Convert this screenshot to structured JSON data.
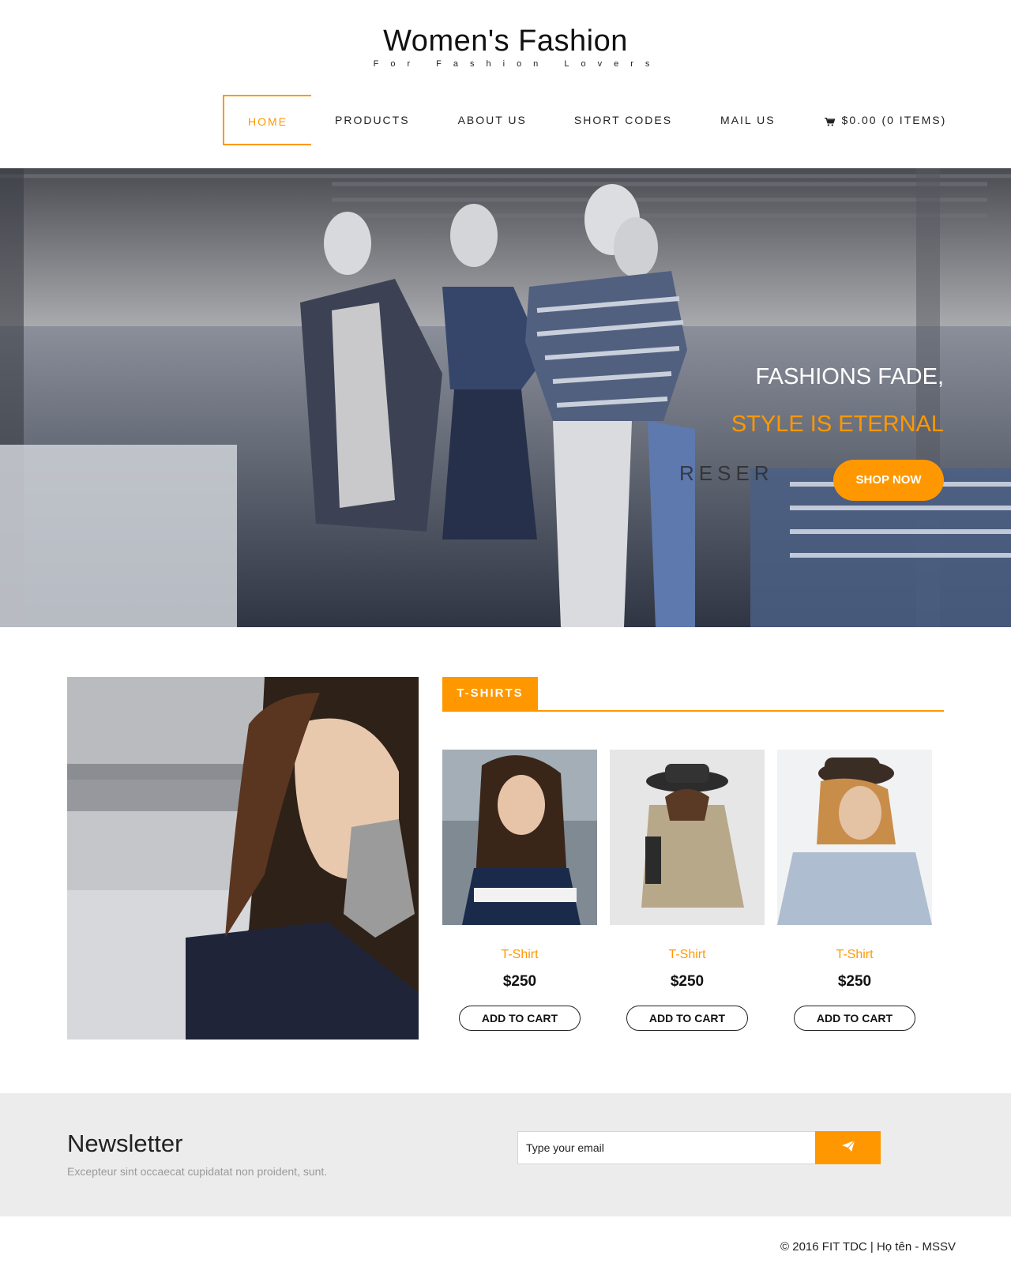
{
  "brand": {
    "title": "Women's Fashion",
    "subtitle": "For Fashion Lovers"
  },
  "nav": {
    "items": [
      "HOME",
      "PRODUCTS",
      "ABOUT US",
      "SHORT CODES",
      "MAIL US"
    ],
    "cart_label": "$0.00 (0 ITEMS)",
    "active_index": 0,
    "cart_icon": "shopping-cart-icon"
  },
  "hero": {
    "line1": "FASHIONS FADE,",
    "line2": "STYLE IS ETERNAL",
    "button": "SHOP NOW"
  },
  "section": {
    "title": "T-SHIRTS",
    "products": [
      {
        "name": "T-Shirt",
        "price": "$250",
        "button": "ADD TO CART"
      },
      {
        "name": "T-Shirt",
        "price": "$250",
        "button": "ADD TO CART"
      },
      {
        "name": "T-Shirt",
        "price": "$250",
        "button": "ADD TO CART"
      }
    ]
  },
  "newsletter": {
    "title": "Newsletter",
    "description": "Excepteur sint occaecat cupidatat non proident, sunt.",
    "placeholder": "Type your email",
    "submit_icon": "paper-plane-icon"
  },
  "footer": {
    "text": "© 2016 FIT TDC | Họ tên - MSSV"
  },
  "colors": {
    "accent": "#ff9800",
    "newsletter_bg": "#ececec",
    "text": "#212121"
  }
}
